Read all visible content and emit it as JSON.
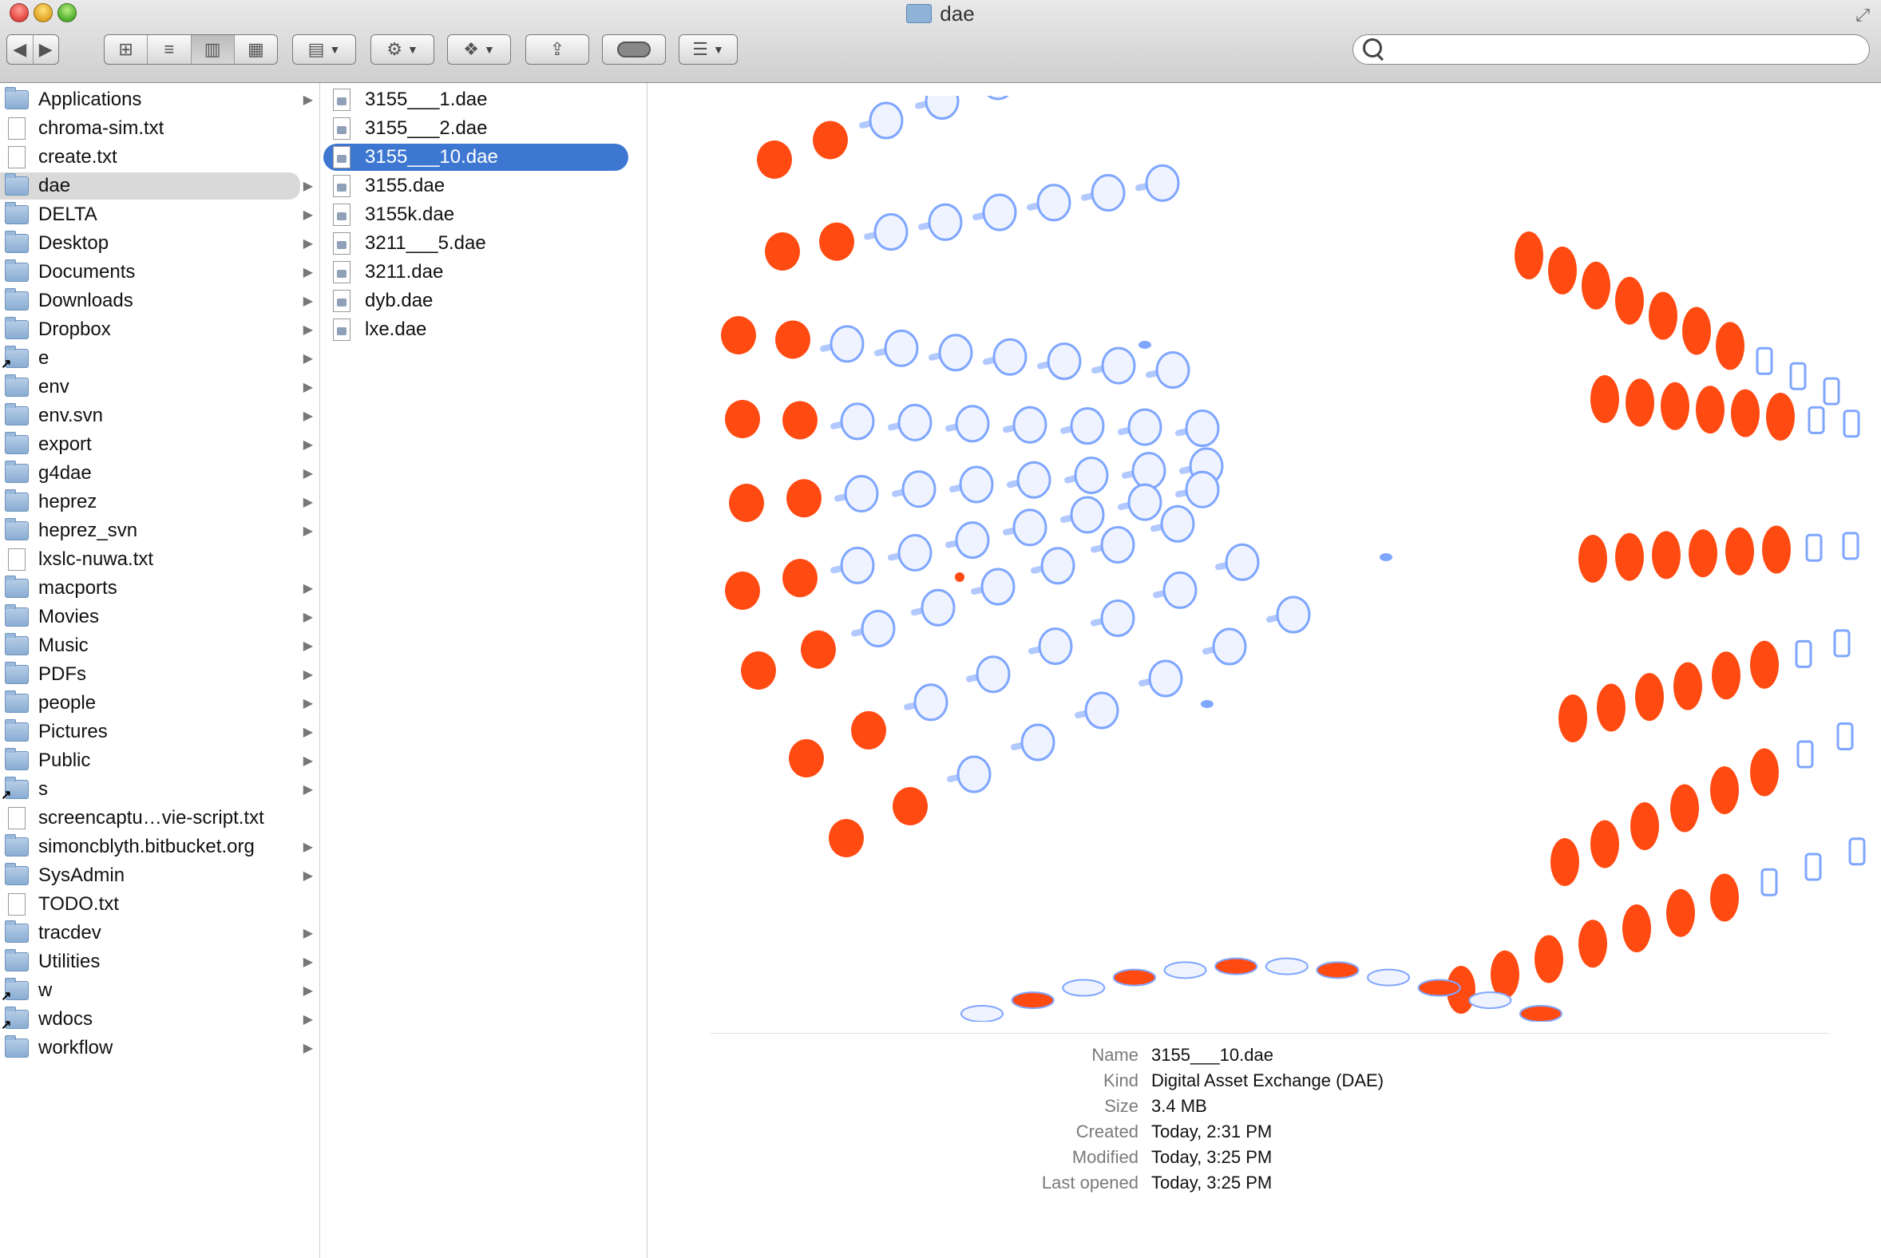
{
  "window": {
    "title": "dae"
  },
  "toolbar": {
    "back_icon": "back-arrow-icon",
    "forward_icon": "forward-arrow-icon",
    "view_modes": [
      "icon-view-icon",
      "list-view-icon",
      "column-view-icon",
      "coverflow-view-icon"
    ],
    "selected_view": "column-view-icon",
    "arrange_icon": "arrange-icon",
    "action_icon": "gear-icon",
    "dropbox_icon": "dropbox-icon",
    "share_icon": "share-icon",
    "toggle_icon": "toggle-icon",
    "list_icon": "list-icon"
  },
  "search": {
    "placeholder": "",
    "value": ""
  },
  "sidebar": {
    "items": [
      {
        "label": "Applications",
        "type": "folder",
        "arrow": true
      },
      {
        "label": "chroma-sim.txt",
        "type": "doc",
        "arrow": false
      },
      {
        "label": "create.txt",
        "type": "doc",
        "arrow": false
      },
      {
        "label": "dae",
        "type": "folder",
        "arrow": true,
        "selected": true
      },
      {
        "label": "DELTA",
        "type": "folder",
        "arrow": true
      },
      {
        "label": "Desktop",
        "type": "folder",
        "arrow": true
      },
      {
        "label": "Documents",
        "type": "folder",
        "arrow": true
      },
      {
        "label": "Downloads",
        "type": "folder",
        "arrow": true
      },
      {
        "label": "Dropbox",
        "type": "folder",
        "arrow": true
      },
      {
        "label": "e",
        "type": "alias",
        "arrow": true
      },
      {
        "label": "env",
        "type": "folder",
        "arrow": true
      },
      {
        "label": "env.svn",
        "type": "folder",
        "arrow": true
      },
      {
        "label": "export",
        "type": "folder",
        "arrow": true
      },
      {
        "label": "g4dae",
        "type": "folder",
        "arrow": true
      },
      {
        "label": "heprez",
        "type": "folder",
        "arrow": true
      },
      {
        "label": "heprez_svn",
        "type": "folder",
        "arrow": true
      },
      {
        "label": "lxslc-nuwa.txt",
        "type": "doc",
        "arrow": false
      },
      {
        "label": "macports",
        "type": "folder",
        "arrow": true
      },
      {
        "label": "Movies",
        "type": "folder",
        "arrow": true
      },
      {
        "label": "Music",
        "type": "folder",
        "arrow": true
      },
      {
        "label": "PDFs",
        "type": "folder",
        "arrow": true
      },
      {
        "label": "people",
        "type": "folder",
        "arrow": true
      },
      {
        "label": "Pictures",
        "type": "folder",
        "arrow": true
      },
      {
        "label": "Public",
        "type": "folder",
        "arrow": true
      },
      {
        "label": "s",
        "type": "alias",
        "arrow": true
      },
      {
        "label": "screencaptu…vie-script.txt",
        "type": "doc",
        "arrow": false
      },
      {
        "label": "simoncblyth.bitbucket.org",
        "type": "folder",
        "arrow": true
      },
      {
        "label": "SysAdmin",
        "type": "folder",
        "arrow": true
      },
      {
        "label": "TODO.txt",
        "type": "doc",
        "arrow": false
      },
      {
        "label": "tracdev",
        "type": "folder",
        "arrow": true
      },
      {
        "label": "Utilities",
        "type": "folder",
        "arrow": true
      },
      {
        "label": "w",
        "type": "alias",
        "arrow": true
      },
      {
        "label": "wdocs",
        "type": "alias",
        "arrow": true
      },
      {
        "label": "workflow",
        "type": "folder",
        "arrow": true
      }
    ]
  },
  "files": {
    "items": [
      {
        "label": "3155___1.dae"
      },
      {
        "label": "3155___2.dae"
      },
      {
        "label": "3155___10.dae",
        "selected": true
      },
      {
        "label": "3155.dae"
      },
      {
        "label": "3155k.dae"
      },
      {
        "label": "3211___5.dae"
      },
      {
        "label": "3211.dae"
      },
      {
        "label": "dyb.dae"
      },
      {
        "label": "lxe.dae"
      }
    ]
  },
  "preview": {
    "colors": {
      "orange": "#ff4a12",
      "blue": "#7fa6ff"
    },
    "info": [
      {
        "key": "Name",
        "value": "3155___10.dae"
      },
      {
        "key": "Kind",
        "value": "Digital Asset Exchange (DAE)"
      },
      {
        "key": "Size",
        "value": "3.4 MB"
      },
      {
        "key": "Created",
        "value": "Today, 2:31 PM"
      },
      {
        "key": "Modified",
        "value": "Today, 3:25 PM"
      },
      {
        "key": "Last opened",
        "value": "Today, 3:25 PM"
      }
    ]
  }
}
